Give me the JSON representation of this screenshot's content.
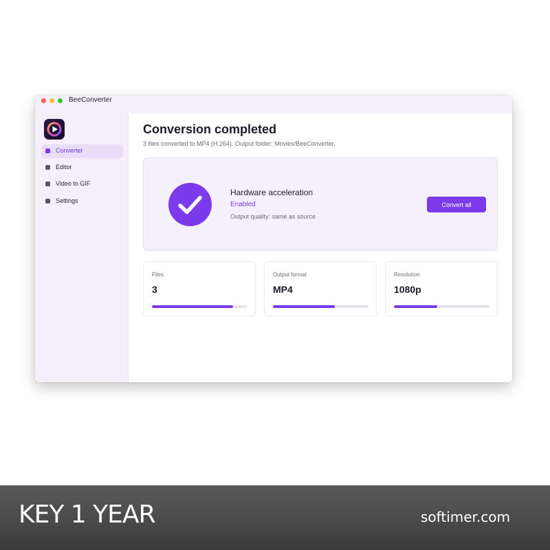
{
  "window": {
    "app_title": "BeeConverter",
    "logo_icon": "beeconverter-logo"
  },
  "sidebar": {
    "items": [
      {
        "label": "Converter",
        "icon": "converter-icon",
        "active": true
      },
      {
        "label": "Editor",
        "icon": "editor-icon",
        "active": false
      },
      {
        "label": "Video to GIF",
        "icon": "gif-icon",
        "active": false
      },
      {
        "label": "Settings",
        "icon": "settings-icon",
        "active": false
      }
    ]
  },
  "main": {
    "title": "Conversion completed",
    "subtitle": "3 files converted to MP4 (H.264). Output folder: Movies/BeeConverter.",
    "hero": {
      "icon": "checkmark-icon",
      "title": "Hardware acceleration",
      "status": "Enabled",
      "quality": "Output quality: same as source",
      "button_label": "Convert all"
    },
    "stats": [
      {
        "label": "Files",
        "value": "3",
        "progress": 0.85
      },
      {
        "label": "Output format",
        "value": "MP4",
        "progress": 0.65
      },
      {
        "label": "Resolution",
        "value": "1080p",
        "progress": 0.45
      }
    ]
  },
  "banner": {
    "title": "KEY 1 YEAR",
    "site": "softimer.com"
  },
  "colors": {
    "accent": "#7c3aed",
    "sidebar_bg": "#f4effb",
    "active_nav_bg": "#e8def8",
    "hero_bg": "#f4f0fc",
    "banner_bg": "#4a4a4a"
  }
}
